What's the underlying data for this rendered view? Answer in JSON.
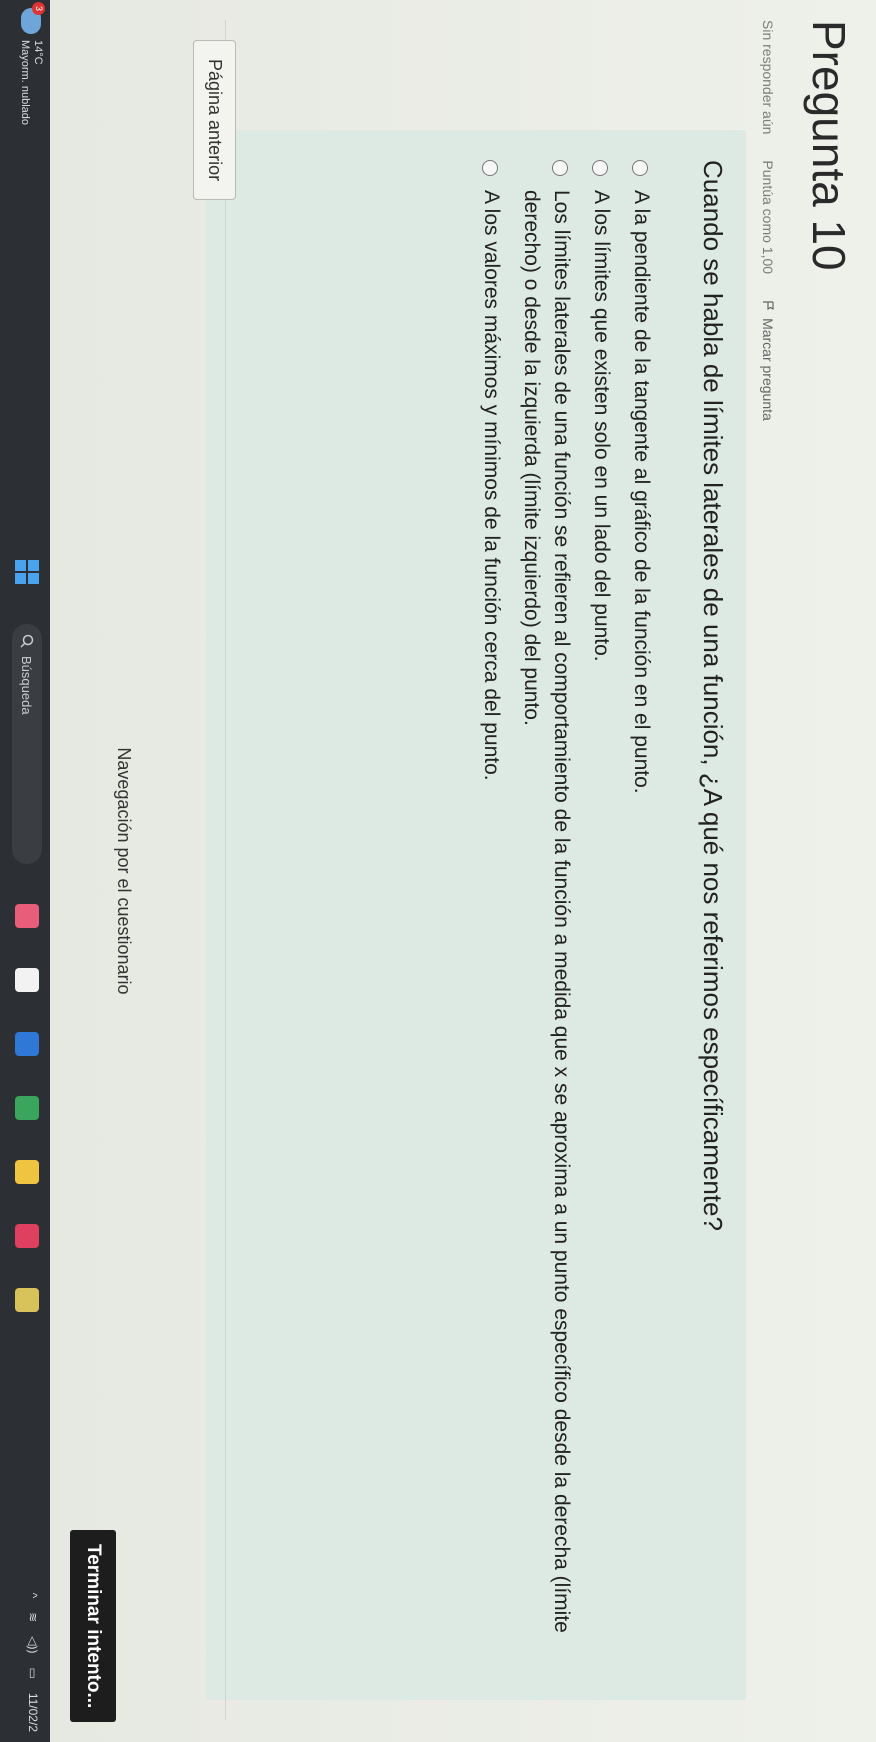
{
  "question": {
    "title": "Pregunta 10",
    "status": "Sin responder aún",
    "score": "Puntúa como 1,00",
    "flag_label": "Marcar pregunta",
    "text": "Cuando se habla de límites laterales de una función, ¿A qué nos referimos específicamente?",
    "options": [
      "A la pendiente de la tangente al gráfico de la función en el punto.",
      "A los límites que existen solo en un lado del punto.",
      "Los límites laterales de una función se refieren al comportamiento de la función a medida que x se aproxima a un punto específico desde la derecha (límite derecho) o desde la izquierda (límite izquierdo) del punto.",
      "A los valores máximos y mínimos de la función cerca del punto."
    ]
  },
  "nav": {
    "prev_button": "Página anterior",
    "nav_label": "Navegación por el cuestionario",
    "finish_button": "Terminar intento..."
  },
  "taskbar": {
    "weather_badge": "3",
    "temperature": "14°C",
    "weather_desc": "Mayorm. nublado",
    "search_placeholder": "Búsqueda",
    "date": "11/02/2"
  }
}
